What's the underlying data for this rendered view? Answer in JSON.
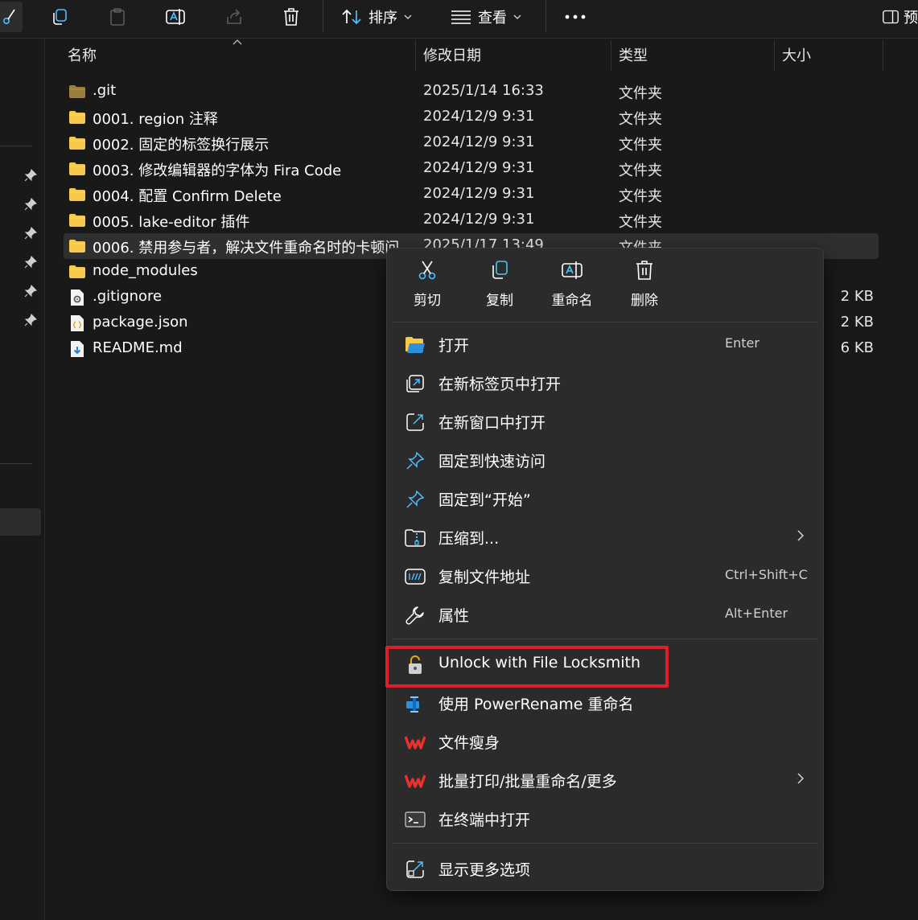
{
  "toolbar": {
    "sort_label": "排序",
    "view_label": "查看",
    "partial_label": "预"
  },
  "columns": {
    "name": "名称",
    "date": "修改日期",
    "type": "类型",
    "size": "大小"
  },
  "files": [
    {
      "name": ".git",
      "date": "2025/1/14 16:33",
      "type": "文件夹",
      "size": "",
      "icon": "folder-dim-icon"
    },
    {
      "name": "0001. region 注释",
      "date": "2024/12/9 9:31",
      "type": "文件夹",
      "size": "",
      "icon": "folder-icon"
    },
    {
      "name": "0002. 固定的标签换行展示",
      "date": "2024/12/9 9:31",
      "type": "文件夹",
      "size": "",
      "icon": "folder-icon"
    },
    {
      "name": "0003. 修改编辑器的字体为 Fira Code",
      "date": "2024/12/9 9:31",
      "type": "文件夹",
      "size": "",
      "icon": "folder-icon"
    },
    {
      "name": "0004. 配置 Confirm Delete",
      "date": "2024/12/9 9:31",
      "type": "文件夹",
      "size": "",
      "icon": "folder-icon"
    },
    {
      "name": "0005. lake-editor 插件",
      "date": "2024/12/9 9:31",
      "type": "文件夹",
      "size": "",
      "icon": "folder-icon"
    },
    {
      "name": "0006. 禁用参与者，解决文件重命名时的卡顿问",
      "date": "2025/1/17 13:49",
      "type": "文件夹",
      "size": "",
      "icon": "folder-icon"
    },
    {
      "name": "node_modules",
      "date": "",
      "type": "",
      "size": "",
      "icon": "folder-icon"
    },
    {
      "name": ".gitignore",
      "date": "",
      "type": "",
      "size": "2 KB",
      "icon": "gear-file-icon"
    },
    {
      "name": "package.json",
      "date": "",
      "type": "",
      "size": "2 KB",
      "icon": "json-file-icon"
    },
    {
      "name": "README.md",
      "date": "",
      "type": "",
      "size": "6 KB",
      "icon": "md-file-icon"
    }
  ],
  "menu": {
    "quick_actions": [
      {
        "label": "剪切",
        "icon": "scissors-icon"
      },
      {
        "label": "复制",
        "icon": "copy-icon"
      },
      {
        "label": "重命名",
        "icon": "rename-icon"
      },
      {
        "label": "删除",
        "icon": "trash-icon"
      }
    ],
    "items": [
      {
        "label": "打开",
        "shortcut": "Enter",
        "icon": "folder-open-icon"
      },
      {
        "label": "在新标签页中打开",
        "shortcut": "",
        "icon": "new-tab-icon"
      },
      {
        "label": "在新窗口中打开",
        "shortcut": "",
        "icon": "new-window-icon"
      },
      {
        "label": "固定到快速访问",
        "shortcut": "",
        "icon": "pin-icon"
      },
      {
        "label": "固定到“开始”",
        "shortcut": "",
        "icon": "pin-start-icon"
      },
      {
        "label": "压缩到...",
        "shortcut": "",
        "icon": "zip-folder-icon"
      },
      {
        "label": "复制文件地址",
        "shortcut": "Ctrl+Shift+C",
        "icon": "copy-path-icon"
      },
      {
        "label": "属性",
        "shortcut": "Alt+Enter",
        "icon": "wrench-icon"
      },
      {
        "label": "Unlock with File Locksmith",
        "shortcut": "",
        "icon": "unlock-icon"
      },
      {
        "label": "使用 PowerRename 重命名",
        "shortcut": "",
        "icon": "powerrename-icon"
      },
      {
        "label": "文件瘦身",
        "shortcut": "",
        "icon": "wps-icon"
      },
      {
        "label": "批量打印/批量重命名/更多",
        "shortcut": "",
        "icon": "wps-icon"
      },
      {
        "label": "在终端中打开",
        "shortcut": "",
        "icon": "terminal-icon"
      },
      {
        "label": "显示更多选项",
        "shortcut": "",
        "icon": "more-options-icon"
      }
    ]
  },
  "colors": {
    "background": "#191919",
    "menu_bg": "#2b2b2b",
    "folder": "#f7c948",
    "accent_blue": "#4cc2ff",
    "highlight_red": "#e01e2b"
  }
}
